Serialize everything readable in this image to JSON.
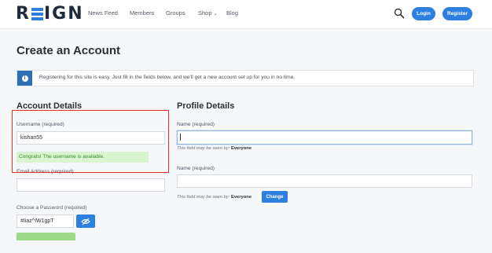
{
  "header": {
    "logo": {
      "left": "R",
      "right": "IGN"
    },
    "nav": [
      "News Feed",
      "Members",
      "Groups",
      "Shop",
      "Blog"
    ],
    "shop_caret": "⌄",
    "login_label": "Login",
    "register_label": "Register"
  },
  "page": {
    "title": "Create an Account",
    "notice": "Registering for this site is easy. Just fill in the fields below, and we'll get a new account set up for you in no time.",
    "info_glyph": "i"
  },
  "account": {
    "title": "Account Details",
    "username_label": "Username (required)",
    "username_value": "kishan55",
    "success_message": "Congrats! The username is available.",
    "email_label": "Email Address (required)",
    "email_value": "",
    "password_label": "Choose a Password (required)",
    "password_value": "#Iiaz^IW1gpT"
  },
  "profile": {
    "title": "Profile Details",
    "name_label": "Name (required)",
    "name_value": "",
    "name_hint_prefix": "This field may be seen by:",
    "name_hint_value": "Everyone",
    "name2_label": "Name (required)",
    "name2_value": "",
    "name2_hint_prefix": "This field may be seen by:",
    "name2_hint_value": "Everyone",
    "change_label": "Change"
  },
  "colors": {
    "accent": "#2d7fe0",
    "success_bg": "#d8f5cf",
    "highlight": "#e0312a"
  }
}
